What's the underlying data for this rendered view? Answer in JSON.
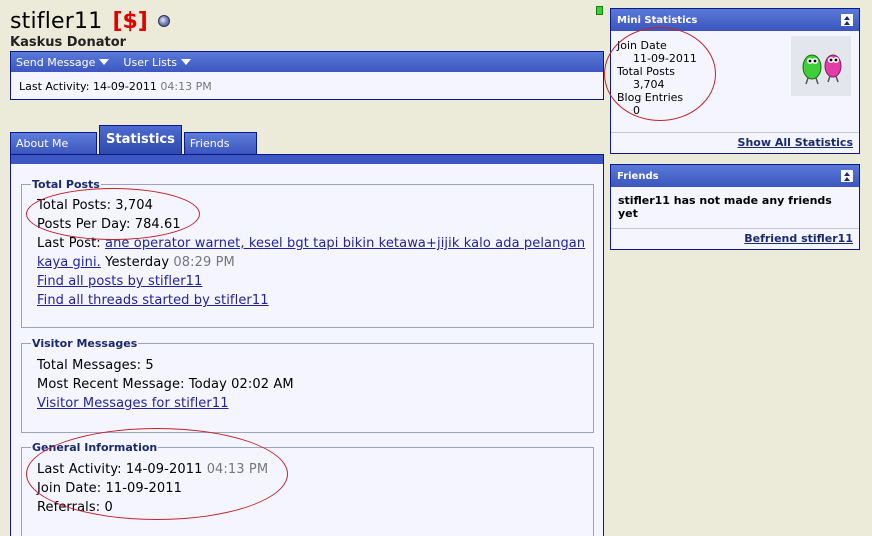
{
  "profile": {
    "username": "stifler11",
    "donator_tag": "[$]",
    "usertitle": "Kaskus Donator"
  },
  "actions": {
    "send_message": "Send Message",
    "user_lists": "User Lists",
    "last_activity_label": "Last Activity: 14-09-2011",
    "last_activity_time": "04:13 PM"
  },
  "tabs": [
    {
      "label": "About Me",
      "active": false
    },
    {
      "label": "Statistics",
      "active": true
    },
    {
      "label": "Friends",
      "active": false
    }
  ],
  "total_posts": {
    "legend": "Total Posts",
    "total_posts": "Total Posts: 3,704",
    "posts_per_day": "Posts Per Day: 784.61",
    "last_post_label": "Last Post:",
    "last_post_link": "ane operator warnet, kesel bgt tapi bikin ketawa+jijik kalo ada pelangan kaya gini.",
    "last_post_day": "Yesterday",
    "last_post_time": "08:29 PM",
    "find_posts": "Find all posts by stifler11",
    "find_threads": "Find all threads started by stifler11"
  },
  "visitor_messages": {
    "legend": "Visitor Messages",
    "total": "Total Messages: 5",
    "most_recent": "Most Recent Message: Today 02:02 AM",
    "link": "Visitor Messages for stifler11"
  },
  "general_info": {
    "legend": "General Information",
    "last_activity": "Last Activity: 14-09-2011",
    "last_activity_time": "04:13 PM",
    "join_date": "Join Date: 11-09-2011",
    "referrals": "Referrals: 0"
  },
  "mini_stats": {
    "title": "Mini Statistics",
    "join_date_label": "Join Date",
    "join_date": "11-09-2011",
    "total_posts_label": "Total Posts",
    "total_posts": "3,704",
    "blog_entries_label": "Blog Entries",
    "blog_entries": "0",
    "show_all": "Show All Statistics"
  },
  "friends_box": {
    "title": "Friends",
    "message": "stifler11 has not made any friends yet",
    "befriend": "Befriend stifler11"
  },
  "colors": {
    "page_bg": "#ecead8",
    "header_blue": "#3d58c2",
    "border_blue": "#0b198c",
    "donator_red": "#e00000",
    "annotation_red": "#c0242a"
  }
}
